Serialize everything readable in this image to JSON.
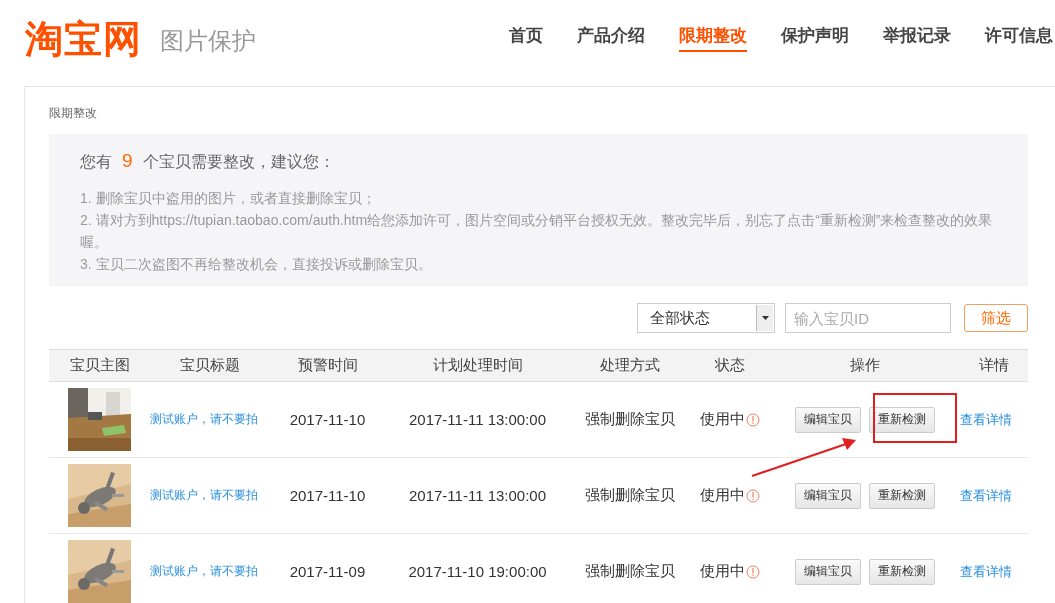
{
  "header": {
    "logo": "淘宝网",
    "subtitle": "图片保护",
    "nav": [
      {
        "label": "首页",
        "selected": false
      },
      {
        "label": "产品介绍",
        "selected": false
      },
      {
        "label": "限期整改",
        "selected": true
      },
      {
        "label": "保护声明",
        "selected": false
      },
      {
        "label": "举报记录",
        "selected": false
      },
      {
        "label": "许可信息",
        "selected": false
      }
    ]
  },
  "breadcrumb": "限期整改",
  "notice": {
    "prefix": "您有",
    "count": "9",
    "suffix": "个宝贝需要整改，建议您：",
    "lines": [
      "1. 删除宝贝中盗用的图片，或者直接删除宝贝；",
      "2. 请对方到https://tupian.taobao.com/auth.htm给您添加许可，图片空间或分销平台授权无效。整改完毕后，别忘了点击“重新检测”来检查整改的效果喔。",
      "3. 宝贝二次盗图不再给整改机会，直接投诉或删除宝贝。"
    ]
  },
  "filter": {
    "status": "全部状态",
    "search_placeholder": "输入宝贝ID",
    "button": "筛选"
  },
  "table": {
    "columns": [
      "宝贝主图",
      "宝贝标题",
      "预警时间",
      "计划处理时间",
      "处理方式",
      "状态",
      "操作",
      "详情"
    ],
    "rows": [
      {
        "title": "测试账户，请不要拍",
        "warn_time": "2017-11-10",
        "plan_time": "2017-11-11 13:00:00",
        "method": "强制删除宝贝",
        "status": "使用中",
        "warning": true,
        "edit": "编辑宝贝",
        "recheck": "重新检测",
        "recheck_highlighted": true,
        "detail": "查看详情"
      },
      {
        "title": "测试账户，请不要拍",
        "warn_time": "2017-11-10",
        "plan_time": "2017-11-11 13:00:00",
        "method": "强制删除宝贝",
        "status": "使用中",
        "warning": true,
        "edit": "编辑宝贝",
        "recheck": "重新检测",
        "recheck_highlighted": false,
        "detail": "查看详情"
      },
      {
        "title": "测试账户，请不要拍",
        "warn_time": "2017-11-09",
        "plan_time": "2017-11-10 19:00:00",
        "method": "强制删除宝贝",
        "status": "使用中",
        "warning": true,
        "edit": "编辑宝贝",
        "recheck": "重新检测",
        "recheck_highlighted": false,
        "detail": "查看详情"
      }
    ]
  }
}
